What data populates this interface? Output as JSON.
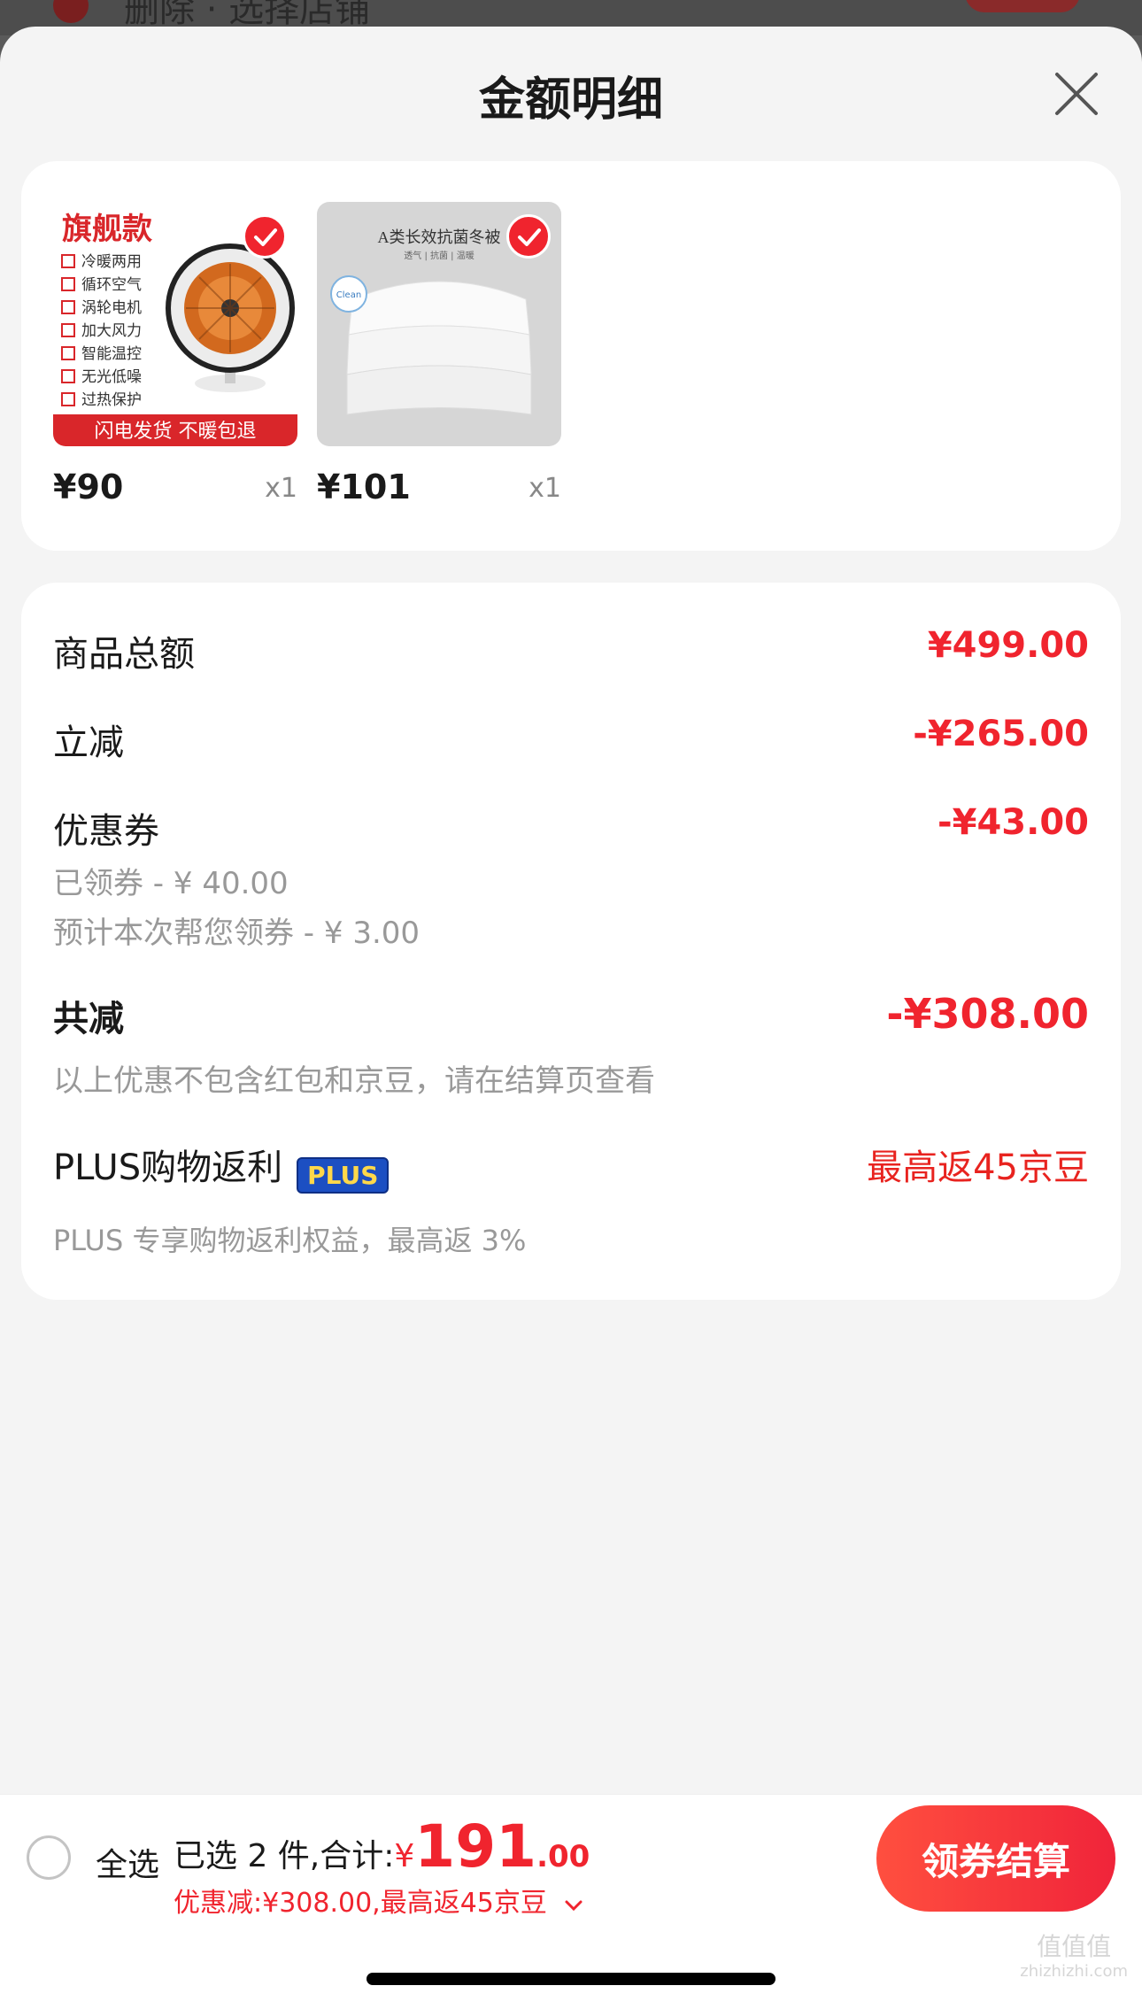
{
  "background": {
    "partial_text": "删除 · 选择店铺"
  },
  "header": {
    "title": "金额明细"
  },
  "products": [
    {
      "price": "¥90",
      "qty": "x1",
      "image": {
        "badge_title": "旗舰款",
        "features": [
          "冷暖两用",
          "循环空气",
          "涡轮电机",
          "加大风力",
          "智能温控",
          "无光低噪",
          "过热保护"
        ],
        "banner": "闪电发货  不暖包退"
      }
    },
    {
      "price": "¥101",
      "qty": "x1",
      "image": {
        "headline": "A类长效抗菌冬被",
        "tagline": "透气 | 抗菌 | 温暖",
        "badge": "Clean"
      }
    }
  ],
  "details": {
    "goods_total": {
      "label": "商品总额",
      "amount": "¥499.00"
    },
    "instant_discount": {
      "label": "立减",
      "amount": "-¥265.00"
    },
    "coupon": {
      "label": "优惠券",
      "amount": "-¥43.00",
      "claimed": "已领券 - ¥ 40.00",
      "estimated": "预计本次帮您领券 - ¥ 3.00"
    },
    "total_saved": {
      "label": "共减",
      "amount": "-¥308.00",
      "note": "以上优惠不包含红包和京豆，请在结算页查看"
    },
    "plus": {
      "label": "PLUS购物返利",
      "badge": "PLUS",
      "amount": "最高返45京豆",
      "note": "PLUS 专享购物返利权益，最高返 3%"
    }
  },
  "bottom_bar": {
    "select_all": "全选",
    "selected_text": "已选 2 件,合计:",
    "currency": "¥",
    "total_integer": "191",
    "total_cents": ".00",
    "discount_line": "优惠减:¥308.00,最高返45京豆",
    "checkout": "领券结算"
  },
  "watermark": {
    "main": "值值值",
    "site": "zhizhizhi.com"
  },
  "colors": {
    "accent": "#f0242e",
    "plus_badge": "#1c4fc2",
    "sheet_bg": "#f4f4f4"
  },
  "icons": [
    "close-icon",
    "check-icon",
    "chevron-down-icon",
    "radio-icon"
  ]
}
